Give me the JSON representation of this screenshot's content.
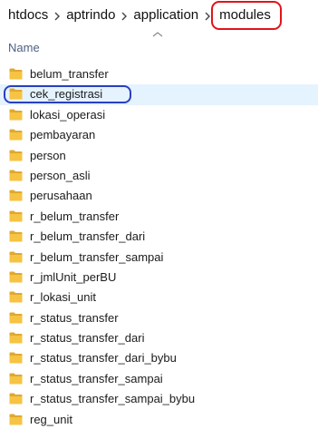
{
  "breadcrumb": {
    "items": [
      "htdocs",
      "aptrindo",
      "application",
      "modules"
    ]
  },
  "column_header": {
    "name_label": "Name",
    "sort_icon": "chevron-up-icon"
  },
  "folders": [
    {
      "name": "belum_transfer",
      "selected": false
    },
    {
      "name": "cek_registrasi",
      "selected": true
    },
    {
      "name": "lokasi_operasi",
      "selected": false
    },
    {
      "name": "pembayaran",
      "selected": false
    },
    {
      "name": "person",
      "selected": false
    },
    {
      "name": "person_asli",
      "selected": false
    },
    {
      "name": "perusahaan",
      "selected": false
    },
    {
      "name": "r_belum_transfer",
      "selected": false
    },
    {
      "name": "r_belum_transfer_dari",
      "selected": false
    },
    {
      "name": "r_belum_transfer_sampai",
      "selected": false
    },
    {
      "name": "r_jmlUnit_perBU",
      "selected": false
    },
    {
      "name": "r_lokasi_unit",
      "selected": false
    },
    {
      "name": "r_status_transfer",
      "selected": false
    },
    {
      "name": "r_status_transfer_dari",
      "selected": false
    },
    {
      "name": "r_status_transfer_dari_bybu",
      "selected": false
    },
    {
      "name": "r_status_transfer_sampai",
      "selected": false
    },
    {
      "name": "r_status_transfer_sampai_bybu",
      "selected": false
    },
    {
      "name": "reg_unit",
      "selected": false
    }
  ],
  "colors": {
    "folder_fill": "#f6c343",
    "folder_dark": "#e0a82e",
    "selection_bg": "#e5f3ff",
    "annotation_red": "#e0141b",
    "annotation_blue": "#2b3fc0"
  }
}
